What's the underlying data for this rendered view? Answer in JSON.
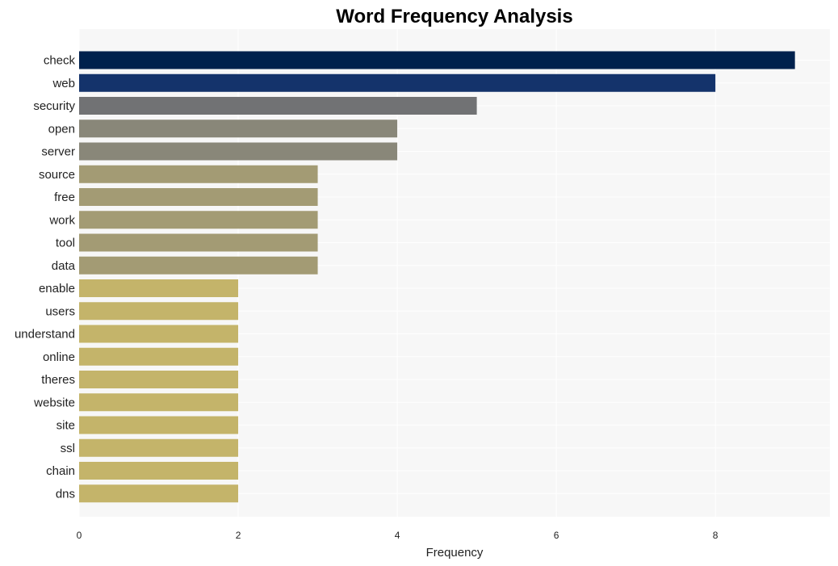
{
  "chart_data": {
    "type": "bar",
    "orientation": "horizontal",
    "title": "Word Frequency Analysis",
    "xlabel": "Frequency",
    "ylabel": "",
    "xlim": [
      0,
      9.44
    ],
    "xticks": [
      0,
      2,
      4,
      6,
      8
    ],
    "grid": true,
    "categories": [
      "check",
      "web",
      "security",
      "open",
      "server",
      "source",
      "free",
      "work",
      "tool",
      "data",
      "enable",
      "users",
      "understand",
      "online",
      "theres",
      "website",
      "site",
      "ssl",
      "chain",
      "dns"
    ],
    "values": [
      9,
      8,
      5,
      4,
      4,
      3,
      3,
      3,
      3,
      3,
      2,
      2,
      2,
      2,
      2,
      2,
      2,
      2,
      2,
      2
    ],
    "colors": [
      "#00214d",
      "#14336b",
      "#717274",
      "#898779",
      "#898779",
      "#a39b74",
      "#a39b74",
      "#a39b74",
      "#a39b74",
      "#a39b74",
      "#c4b46a",
      "#c4b46a",
      "#c4b46a",
      "#c4b46a",
      "#c4b46a",
      "#c4b46a",
      "#c4b46a",
      "#c4b46a",
      "#c4b46a",
      "#c4b46a"
    ],
    "plot_background": "#f7f7f7"
  }
}
